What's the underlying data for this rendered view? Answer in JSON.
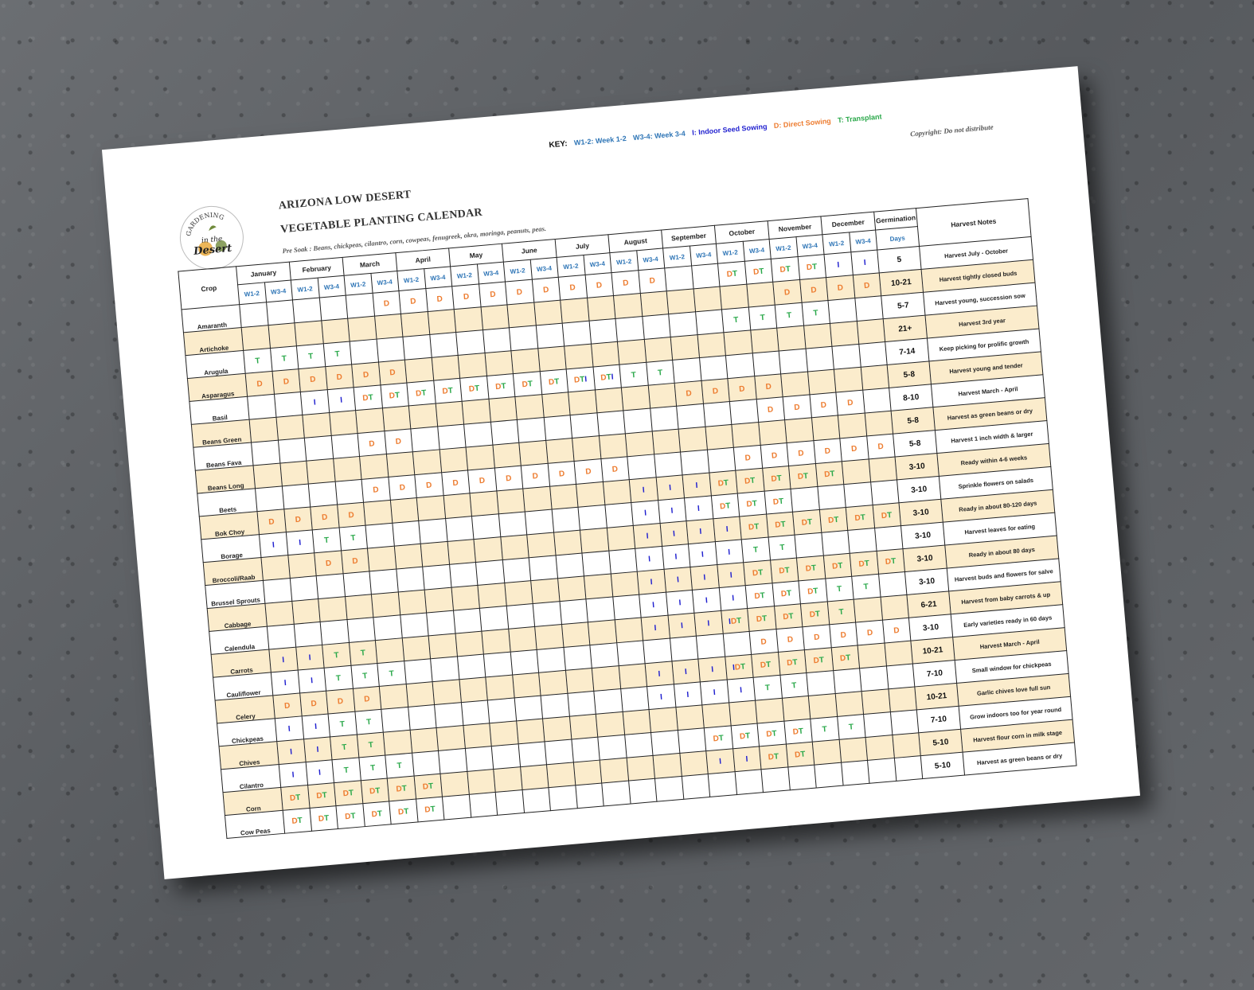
{
  "key": {
    "label": "KEY:",
    "w12": "W1-2: Week 1-2",
    "w34": "W3-4: Week 3-4",
    "indoor": "I: Indoor Seed Sowing",
    "direct": "D: Direct Sowing",
    "transplant": "T: Transplant"
  },
  "copyright": "Copyright: Do not distribute",
  "logo": {
    "top": "GARDENING",
    "middle": "in the",
    "bottom": "Desert"
  },
  "title_line1": "ARIZONA LOW DESERT",
  "title_line2": "VEGETABLE PLANTING CALENDAR",
  "presoak": "Pre Soak : Beans, chickpeas, cilantro, corn, cowpeas, fenugreek, okra, moringa, peanuts, peas.",
  "headers": {
    "crop": "Crop",
    "months": [
      "January",
      "February",
      "March",
      "April",
      "May",
      "June",
      "July",
      "August",
      "September",
      "October",
      "November",
      "December"
    ],
    "germination": "Germination",
    "days": "Days",
    "notes": "Harvest Notes",
    "w12": "W1-2",
    "w34": "W3-4"
  },
  "colors": {
    "direct": "#ed7d31",
    "transplant": "#2aa84a",
    "indoor": "#1f1fcf",
    "week": "#2e75b6",
    "stripe": "#fbeccc"
  },
  "rows": [
    {
      "crop": "Amaranth",
      "days": "5",
      "note": "Harvest July - October",
      "cells": [
        "",
        "",
        "",
        "",
        "",
        "D",
        "D",
        "D",
        "D",
        "D",
        "D",
        "D",
        "D",
        "D",
        "D",
        "D",
        "",
        "",
        "DT",
        "DT",
        "DT",
        "DT",
        "I",
        "I"
      ]
    },
    {
      "crop": "Artichoke",
      "days": "10-21",
      "note": "Harvest tightly closed buds",
      "cells": [
        "",
        "",
        "",
        "",
        "",
        "",
        "",
        "",
        "",
        "",
        "",
        "",
        "",
        "",
        "",
        "",
        "",
        "",
        "",
        "",
        "D",
        "D",
        "D",
        "D"
      ]
    },
    {
      "crop": "Arugula",
      "days": "5-7",
      "note": "Harvest young, succession sow",
      "cells": [
        "T",
        "T",
        "T",
        "T",
        "",
        "",
        "",
        "",
        "",
        "",
        "",
        "",
        "",
        "",
        "",
        "",
        "",
        "",
        "T",
        "T",
        "T",
        "T",
        "",
        ""
      ]
    },
    {
      "crop": "Asparagus",
      "days": "21+",
      "note": "Harvest 3rd year",
      "cells": [
        "D",
        "D",
        "D",
        "D",
        "D",
        "D",
        "",
        "",
        "",
        "",
        "",
        "",
        "",
        "",
        "",
        "",
        "",
        "",
        "",
        "",
        "",
        "",
        "",
        ""
      ]
    },
    {
      "crop": "Basil",
      "days": "7-14",
      "note": "Keep picking for prolific growth",
      "cells": [
        "",
        "",
        "I",
        "I",
        "DT",
        "DT",
        "DT",
        "DT",
        "DT",
        "DT",
        "DT",
        "DT",
        "DTI",
        "DTI",
        "T",
        "T",
        "",
        "",
        "",
        "",
        "",
        "",
        "",
        ""
      ]
    },
    {
      "crop": "Beans Green",
      "days": "5-8",
      "note": "Harvest young and tender",
      "cells": [
        "",
        "",
        "",
        "",
        "",
        "",
        "",
        "",
        "",
        "",
        "",
        "",
        "",
        "",
        "",
        "",
        "D",
        "D",
        "D",
        "D",
        "",
        "",
        "",
        ""
      ]
    },
    {
      "crop": "Beans Fava",
      "days": "8-10",
      "note": "Harvest March - April",
      "cells": [
        "",
        "",
        "",
        "",
        "D",
        "D",
        "",
        "",
        "",
        "",
        "",
        "",
        "",
        "",
        "",
        "",
        "",
        "",
        "",
        "D",
        "D",
        "D",
        "D",
        ""
      ]
    },
    {
      "crop": "Beans Long",
      "days": "5-8",
      "note": "Harvest as green beans or dry",
      "cells": [
        "",
        "",
        "",
        "",
        "",
        "",
        "",
        "",
        "",
        "",
        "",
        "",
        "",
        "",
        "",
        "",
        "",
        "",
        "",
        "",
        "",
        "",
        "",
        ""
      ]
    },
    {
      "crop": "Beets",
      "days": "5-8",
      "note": "Harvest 1 inch width & larger",
      "cells": [
        "",
        "",
        "",
        "",
        "D",
        "D",
        "D",
        "D",
        "D",
        "D",
        "D",
        "D",
        "D",
        "D",
        "",
        "",
        "",
        "",
        "D",
        "D",
        "D",
        "D",
        "D",
        "D"
      ]
    },
    {
      "crop": "Bok Choy",
      "days": "3-10",
      "note": "Ready within 4-6 weeks",
      "cells": [
        "D",
        "D",
        "D",
        "D",
        "",
        "",
        "",
        "",
        "",
        "",
        "",
        "",
        "",
        "",
        "I",
        "I",
        "I",
        "DT",
        "DT",
        "DT",
        "DT",
        "DT",
        "",
        ""
      ]
    },
    {
      "crop": "Borage",
      "days": "3-10",
      "note": "Sprinkle flowers on salads",
      "cells": [
        "I",
        "I",
        "T",
        "T",
        "",
        "",
        "",
        "",
        "",
        "",
        "",
        "",
        "",
        "",
        "I",
        "I",
        "I",
        "DT",
        "DT",
        "DT",
        "",
        "",
        "",
        ""
      ]
    },
    {
      "crop": "Broccoli/Raab",
      "days": "3-10",
      "note": "Ready in about 80-120 days",
      "cells": [
        "",
        "",
        "D",
        "D",
        "",
        "",
        "",
        "",
        "",
        "",
        "",
        "",
        "",
        "",
        "I",
        "I",
        "I",
        "I",
        "DT",
        "DT",
        "DT",
        "DT",
        "DT",
        "DT"
      ]
    },
    {
      "crop": "Brussel Sprouts",
      "days": "3-10",
      "note": "Harvest leaves for eating",
      "cells": [
        "",
        "",
        "",
        "",
        "",
        "",
        "",
        "",
        "",
        "",
        "",
        "",
        "",
        "",
        "I",
        "I",
        "I",
        "I",
        "T",
        "T",
        "",
        "",
        "",
        ""
      ]
    },
    {
      "crop": "Cabbage",
      "days": "3-10",
      "note": "Ready in about 80 days",
      "cells": [
        "",
        "",
        "",
        "",
        "",
        "",
        "",
        "",
        "",
        "",
        "",
        "",
        "",
        "",
        "I",
        "I",
        "I",
        "I",
        "DT",
        "DT",
        "DT",
        "DT",
        "DT",
        "DT"
      ]
    },
    {
      "crop": "Calendula",
      "days": "3-10",
      "note": "Harvest buds and flowers for salve",
      "cells": [
        "",
        "",
        "",
        "",
        "",
        "",
        "",
        "",
        "",
        "",
        "",
        "",
        "",
        "",
        "I",
        "I",
        "I",
        "I",
        "DT",
        "DT",
        "DT",
        "T",
        "T",
        ""
      ]
    },
    {
      "crop": "Carrots",
      "days": "6-21",
      "note": "Harvest from baby carrots & up",
      "cells": [
        "I",
        "I",
        "T",
        "T",
        "",
        "",
        "",
        "",
        "",
        "",
        "",
        "",
        "",
        "",
        "I",
        "I",
        "I",
        "IDT",
        "DT",
        "DT",
        "DT",
        "T",
        "",
        ""
      ]
    },
    {
      "crop": "Cauliflower",
      "days": "3-10",
      "note": "Early varieties ready in 60 days",
      "cells": [
        "I",
        "I",
        "T",
        "T",
        "T",
        "",
        "",
        "",
        "",
        "",
        "",
        "",
        "",
        "",
        "",
        "",
        "",
        "",
        "D",
        "D",
        "D",
        "D",
        "D",
        "D"
      ]
    },
    {
      "crop": "Celery",
      "days": "10-21",
      "note": "Harvest March - April",
      "cells": [
        "D",
        "D",
        "D",
        "D",
        "",
        "",
        "",
        "",
        "",
        "",
        "",
        "",
        "",
        "",
        "I",
        "I",
        "I",
        "IDT",
        "DT",
        "DT",
        "DT",
        "DT",
        "",
        ""
      ]
    },
    {
      "crop": "Chickpeas",
      "days": "7-10",
      "note": "Small window for chickpeas",
      "cells": [
        "I",
        "I",
        "T",
        "T",
        "",
        "",
        "",
        "",
        "",
        "",
        "",
        "",
        "",
        "",
        "I",
        "I",
        "I",
        "I",
        "T",
        "T",
        "",
        "",
        "",
        ""
      ]
    },
    {
      "crop": "Chives",
      "days": "10-21",
      "note": "Garlic chives love full sun",
      "cells": [
        "I",
        "I",
        "T",
        "T",
        "",
        "",
        "",
        "",
        "",
        "",
        "",
        "",
        "",
        "",
        "",
        "",
        "",
        "",
        "",
        "",
        "",
        "",
        "",
        ""
      ]
    },
    {
      "crop": "Cilantro",
      "days": "7-10",
      "note": "Grow indoors too for year round",
      "cells": [
        "I",
        "I",
        "T",
        "T",
        "T",
        "",
        "",
        "",
        "",
        "",
        "",
        "",
        "",
        "",
        "",
        "",
        "DT",
        "DT",
        "DT",
        "DT",
        "T",
        "T",
        "",
        ""
      ]
    },
    {
      "crop": "Corn",
      "days": "5-10",
      "note": "Harvest flour corn in milk stage",
      "cells": [
        "DT",
        "DT",
        "DT",
        "DT",
        "DT",
        "DT",
        "",
        "",
        "",
        "",
        "",
        "",
        "",
        "",
        "",
        "",
        "I",
        "I",
        "DT",
        "DT",
        "",
        "",
        "",
        ""
      ]
    },
    {
      "crop": "Cow Peas",
      "days": "5-10",
      "note": "Harvest as green beans or dry",
      "cells": [
        "DT",
        "DT",
        "DT",
        "DT",
        "DT",
        "DT",
        "",
        "",
        "",
        "",
        "",
        "",
        "",
        "",
        "",
        "",
        "",
        "",
        "",
        "",
        "",
        "",
        "",
        ""
      ]
    }
  ]
}
